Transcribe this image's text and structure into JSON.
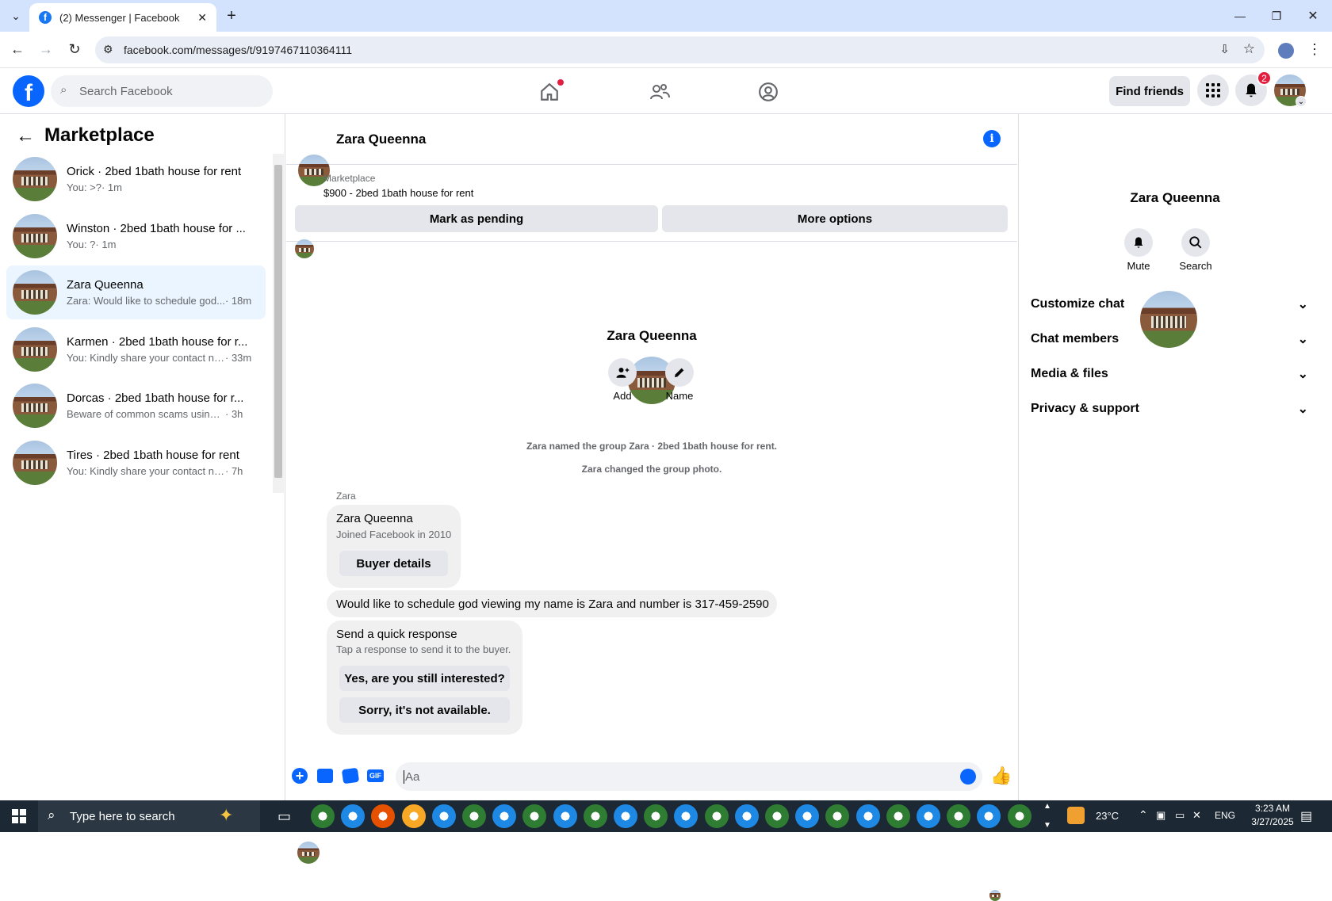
{
  "browser": {
    "tab_title": "(2) Messenger | Facebook",
    "url": "facebook.com/messages/t/9197467110364111"
  },
  "fb": {
    "search_placeholder": "Search Facebook",
    "find_friends": "Find friends",
    "notif_count": "2"
  },
  "left": {
    "title": "Marketplace",
    "conversations": [
      {
        "name": "Orick · 2bed 1bath house for rent",
        "preview": "You: >?",
        "time": "· 1m"
      },
      {
        "name": "Winston · 2bed 1bath house for ...",
        "preview": "You: ?",
        "time": "· 1m"
      },
      {
        "name": "Zara Queenna",
        "preview": "Zara: Would like to schedule god...",
        "time": "· 18m"
      },
      {
        "name": "Karmen · 2bed 1bath house for r...",
        "preview": "You: Kindly share your contact nu...",
        "time": "· 33m"
      },
      {
        "name": "Dorcas · 2bed 1bath house for r...",
        "preview": "Beware of common scams using p...",
        "time": "· 3h"
      },
      {
        "name": "Tires · 2bed 1bath house for rent",
        "preview": "You: Kindly share your contact num...",
        "time": "· 7h"
      }
    ]
  },
  "chat": {
    "name": "Zara Queenna",
    "listing_label": "Marketplace",
    "listing_title": "$900 - 2bed 1bath house for rent",
    "mark_pending": "Mark as pending",
    "more_options": "More options",
    "profile_name": "Zara Queenna",
    "add_label": "Add",
    "name_label": "Name",
    "sys1": "Zara named the group Zara · 2bed 1bath house for rent.",
    "sys2": "Zara changed the group photo.",
    "sender": "Zara",
    "card_name": "Zara Queenna",
    "card_sub": "Joined Facebook in 2010",
    "buyer_details": "Buyer details",
    "message": "Would like to schedule god viewing my name is Zara and number is 317-459-2590",
    "quick_title": "Send a quick response",
    "quick_sub": "Tap a response to send it to the buyer.",
    "quick1": "Yes, are you still interested?",
    "quick2": "Sorry, it's not available.",
    "input_placeholder": "Aa"
  },
  "right": {
    "name": "Zara Queenna",
    "mute": "Mute",
    "search": "Search",
    "sections": [
      "Customize chat",
      "Chat members",
      "Media & files",
      "Privacy & support"
    ]
  },
  "taskbar": {
    "search_placeholder": "Type here to search",
    "temp": "23°C",
    "lang": "ENG",
    "time": "3:23 AM",
    "date": "3/27/2025"
  },
  "colors": {
    "accent": "#0866ff",
    "badge": "#e41e3f",
    "selected": "#ebf5ff"
  }
}
